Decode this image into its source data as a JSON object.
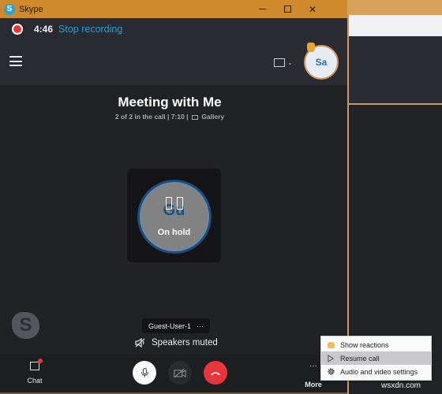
{
  "window": {
    "title": "Skype",
    "app_icon_letter": "S",
    "controls": {
      "minimize": "minimize",
      "maximize": "maximize",
      "close": "✕"
    }
  },
  "recording": {
    "elapsed": "4:46",
    "stop_label": "Stop recording",
    "status_color": "#e8353b"
  },
  "header": {
    "menu_icon": "hamburger-icon",
    "view_icon": "view-layout-icon",
    "view_chevron": "⌄",
    "self_avatar_initials": "Sa",
    "self_avatar_hand_icon": "raised-hand-icon"
  },
  "meeting": {
    "title": "Meeting with Me",
    "participants": "2 of 2 in the call",
    "separator": "|",
    "duration": "7:10",
    "view_mode": "Gallery"
  },
  "participant_tile": {
    "initials": "Gu",
    "status": "On hold",
    "name": "Guest-User-1",
    "options": "···"
  },
  "speaker_status": "Speakers muted",
  "watermark_logo": "S",
  "callbar": {
    "chat_label": "Chat",
    "more_label": "More",
    "more_dots": "···",
    "end_call_color": "#e8353b"
  },
  "context_menu": {
    "items": [
      {
        "label": "Show reactions",
        "icon": "reaction-hand-icon",
        "active": false
      },
      {
        "label": "Resume call",
        "icon": "play-icon",
        "active": true
      },
      {
        "label": "Audio and video settings",
        "icon": "gear-icon",
        "active": false
      }
    ]
  },
  "site_watermark": "wsxdn.com",
  "colors": {
    "titlebar": "#cf8a2c",
    "link": "#2d9bd6",
    "background": "#212224"
  }
}
